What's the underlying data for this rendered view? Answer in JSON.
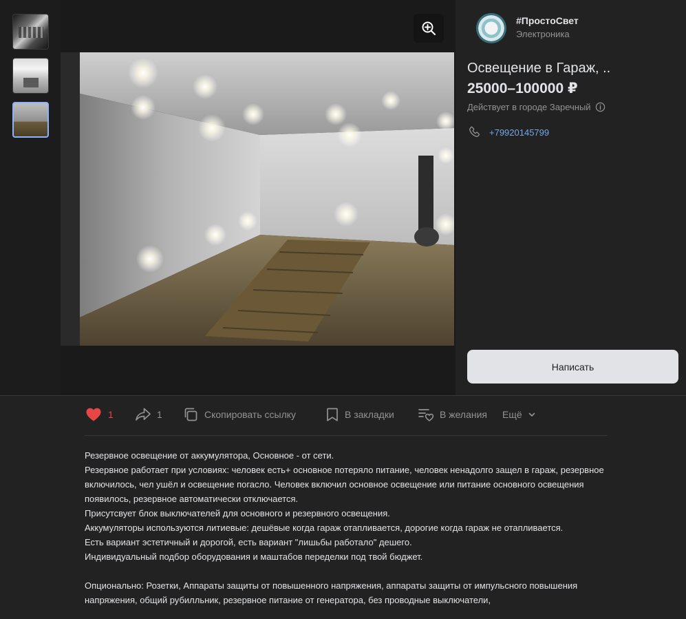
{
  "seller": {
    "name": "#ПростоСвет",
    "category": "Электроника"
  },
  "item": {
    "title": "Освещение в Гараж, ..",
    "price": "25000–100000 ₽",
    "city_note": "Действует в городе Заречный",
    "phone": "+79920145799",
    "write_label": "Написать"
  },
  "actions": {
    "like_count": "1",
    "share_count": "1",
    "copy_label": "Скопировать ссылку",
    "bookmark_label": "В закладки",
    "wish_label": "В желания",
    "more_label": "Ещё"
  },
  "colors": {
    "background": "#222222",
    "accent_link": "#71aaeb",
    "like_red": "#e64646",
    "button_bg": "#e1e3e6",
    "selected_thumb_border": "#8fb3ff"
  },
  "description": {
    "p1": "Резервное освещение от аккумулятора, Основное - от сети.",
    "p2": "Резервное работает при условиях: человек есть+ основное потеряло питание, человек ненадолго защел в гараж, резервное включилось, чел ушёл и освещение погасло. Человек включил основное освещение или питание основного освещения появилось, резервное автоматически отключается.",
    "p3": "Присутсвует блок выключателей для основного и резервного освещения.",
    "p4": "Аккумуляторы используются литиевые: дешёвые когда гараж отапливается, дорогие когда гараж не отапливается.",
    "p5": "Есть вариант эстетичный и дорогой, есть вариант \"лишьбы работало\" дешего.",
    "p6": "Индивидуальный подбор оборудования и маштабов переделки под твой бюджет.",
    "p7": "Опционально: Розетки, Аппараты защиты от повышенного напряжения, аппараты защиты от импульсного повышения напряжения, общий рубилльник, резервное питание от генератора, без проводные выключатели,"
  },
  "icons": {
    "zoom": "zoom-in-icon",
    "info": "info-icon",
    "phone": "phone-icon",
    "like": "heart-icon",
    "share": "share-icon",
    "copy": "copy-icon",
    "bookmark": "bookmark-icon",
    "wish": "wishlist-icon",
    "more": "chevron-down-icon"
  }
}
